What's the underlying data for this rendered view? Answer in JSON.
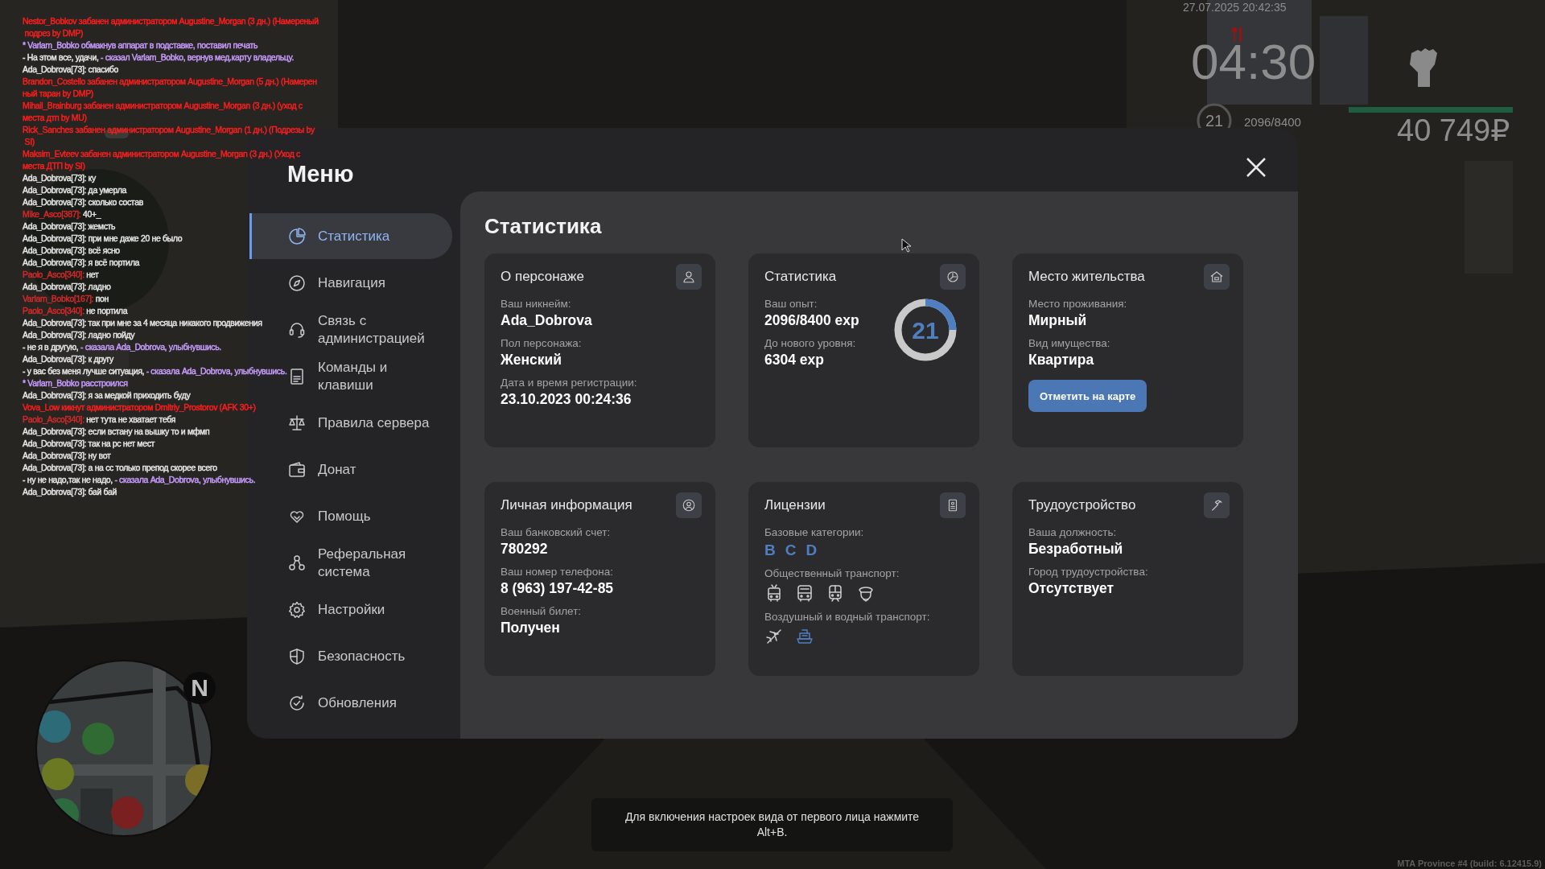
{
  "chat": [
    {
      "segments": [
        {
          "text": "Nestor_Bobkov забанен администратором Augustine_Morgan (3 дн.) (Намереный",
          "color": "#ff1e1e"
        }
      ]
    },
    {
      "segments": [
        {
          "text": " подрез by DMP)",
          "color": "#ff1e1e"
        }
      ]
    },
    {
      "segments": [
        {
          "text": "* Varlam_Bobko обмакнув аппарат в подставке, поставил печать",
          "color": "#c99cff"
        }
      ]
    },
    {
      "segments": [
        {
          "text": "- На этом все, удачи, ",
          "color": "#e6e6e6"
        },
        {
          "text": "- сказал Varlam_Bobko, вернув мед.карту владельцу.",
          "color": "#c99cff"
        }
      ]
    },
    {
      "segments": [
        {
          "text": "Ada_Dobrova[73]: спасибо",
          "color": "#e6e6e6"
        }
      ]
    },
    {
      "segments": [
        {
          "text": "Brandon_Costello забанен администратором Augustine_Morgan (5 дн.) (Намерен",
          "color": "#ff1e1e"
        }
      ]
    },
    {
      "segments": [
        {
          "text": "ный таран by DMP)",
          "color": "#ff1e1e"
        }
      ]
    },
    {
      "segments": [
        {
          "text": "Mihail_Brainburg забанен администратором Augustine_Morgan (3 дн.) (уход с",
          "color": "#ff1e1e"
        }
      ]
    },
    {
      "segments": [
        {
          "text": "места дтп by MU)",
          "color": "#ff1e1e"
        }
      ]
    },
    {
      "segments": [
        {
          "text": "Rick_Sanches забанен администратором Augustine_Morgan (1 дн.) (Подрезы by",
          "color": "#ff1e1e"
        }
      ]
    },
    {
      "segments": [
        {
          "text": " SI)",
          "color": "#ff1e1e"
        }
      ]
    },
    {
      "segments": [
        {
          "text": "Maksim_Evteev забанен администратором Augustine_Morgan (3 дн.) (Уход с",
          "color": "#ff1e1e"
        }
      ]
    },
    {
      "segments": [
        {
          "text": "места ДТП by SI)",
          "color": "#ff1e1e"
        }
      ]
    },
    {
      "segments": [
        {
          "text": "Ada_Dobrova[73]: ку",
          "color": "#e6e6e6"
        }
      ]
    },
    {
      "segments": [
        {
          "text": "Ada_Dobrova[73]: да умерла",
          "color": "#e6e6e6"
        }
      ]
    },
    {
      "segments": [
        {
          "text": "Ada_Dobrova[73]: сколько состав",
          "color": "#e6e6e6"
        }
      ]
    },
    {
      "segments": [
        {
          "text": "Mike_Asco[387]:",
          "color": "#d42a2a"
        },
        {
          "text": " 40+_",
          "color": "#e6e6e6"
        }
      ]
    },
    {
      "segments": [
        {
          "text": "Ada_Dobrova[73]: жемсть",
          "color": "#e6e6e6"
        }
      ]
    },
    {
      "segments": [
        {
          "text": "Ada_Dobrova[73]: при мне даже 20 не было",
          "color": "#e6e6e6"
        }
      ]
    },
    {
      "segments": [
        {
          "text": "Ada_Dobrova[73]: всё ясно",
          "color": "#e6e6e6"
        }
      ]
    },
    {
      "segments": [
        {
          "text": "Ada_Dobrova[73]: я всё портила",
          "color": "#e6e6e6"
        }
      ]
    },
    {
      "segments": [
        {
          "text": "Paolo_Asco[340]:",
          "color": "#d42a2a"
        },
        {
          "text": " нет",
          "color": "#e6e6e6"
        }
      ]
    },
    {
      "segments": [
        {
          "text": "Ada_Dobrova[73]: ладно",
          "color": "#e6e6e6"
        }
      ]
    },
    {
      "segments": [
        {
          "text": "Varlam_Bobko[167]:",
          "color": "#d42a2a"
        },
        {
          "text": " пон",
          "color": "#e6e6e6"
        }
      ]
    },
    {
      "segments": [
        {
          "text": "Paolo_Asco[340]:",
          "color": "#d42a2a"
        },
        {
          "text": " не портила",
          "color": "#e6e6e6"
        }
      ]
    },
    {
      "segments": [
        {
          "text": "Ada_Dobrova[73]: так при мне за 4 месяца никакого продвижения",
          "color": "#e6e6e6"
        }
      ]
    },
    {
      "segments": [
        {
          "text": "Ada_Dobrova[73]: ладно пойду",
          "color": "#e6e6e6"
        }
      ]
    },
    {
      "segments": [
        {
          "text": "- не я в другую, ",
          "color": "#e6e6e6"
        },
        {
          "text": "- сказала Ada_Dobrova, улыбнувшись.",
          "color": "#c99cff"
        }
      ]
    },
    {
      "segments": [
        {
          "text": "Ada_Dobrova[73]: к другу",
          "color": "#e6e6e6"
        }
      ]
    },
    {
      "segments": [
        {
          "text": "- у вас без меня лучше ситуация, ",
          "color": "#e6e6e6"
        },
        {
          "text": "- сказала Ada_Dobrova, улыбнувшись.",
          "color": "#c99cff"
        }
      ]
    },
    {
      "segments": [
        {
          "text": "* Varlam_Bobko расстроился",
          "color": "#c99cff"
        }
      ]
    },
    {
      "segments": [
        {
          "text": "Ada_Dobrova[73]: я за медкой приходить буду",
          "color": "#e6e6e6"
        }
      ]
    },
    {
      "segments": [
        {
          "text": "Vova_Low кикнут администратором Dmitriy_Prostorov (AFK 30+)",
          "color": "#ff1e1e"
        }
      ]
    },
    {
      "segments": [
        {
          "text": "Paolo_Asco[340]:",
          "color": "#d42a2a"
        },
        {
          "text": " нет тута не хватает тебя",
          "color": "#e6e6e6"
        }
      ]
    },
    {
      "segments": [
        {
          "text": "Ada_Dobrova[73]: если встану на вышку то и мфмп",
          "color": "#e6e6e6"
        }
      ]
    },
    {
      "segments": [
        {
          "text": "Ada_Dobrova[73]: так на рс нет мест",
          "color": "#e6e6e6"
        }
      ]
    },
    {
      "segments": [
        {
          "text": "Ada_Dobrova[73]: ну вот",
          "color": "#e6e6e6"
        }
      ]
    },
    {
      "segments": [
        {
          "text": "Ada_Dobrova[73]: а на сс только препод скорее всего",
          "color": "#e6e6e6"
        }
      ]
    },
    {
      "segments": [
        {
          "text": "- ну не надо,так не надо, ",
          "color": "#e6e6e6"
        },
        {
          "text": "- сказала Ada_Dobrova, улыбнувшись.",
          "color": "#c99cff"
        }
      ]
    },
    {
      "segments": [
        {
          "text": "Ada_Dobrova[73]: бай бай",
          "color": "#e6e6e6"
        }
      ]
    }
  ],
  "hud": {
    "datetime": "27.07.2025 20:42:35",
    "time": "04:30",
    "level_badge": "21",
    "experience": "2096/8400",
    "health": {
      "level": 1
    },
    "money": "40 749₽"
  },
  "minimap": {
    "north": "N"
  },
  "menu": {
    "title": "Меню",
    "sidebar": {
      "items": [
        {
          "label": "Статистика",
          "selected": true
        },
        {
          "label": "Навигация",
          "selected": false
        },
        {
          "label": "Связь с администрацией",
          "selected": false
        },
        {
          "label": "Команды и клавиши",
          "selected": false
        },
        {
          "label": "Правила сервера",
          "selected": false
        },
        {
          "label": "Донат",
          "selected": false
        },
        {
          "label": "Помощь",
          "selected": false
        },
        {
          "label": "Реферальная система",
          "selected": false
        },
        {
          "label": "Настройки",
          "selected": false
        },
        {
          "label": "Безопасность",
          "selected": false
        },
        {
          "label": "Обновления",
          "selected": false
        }
      ]
    },
    "page_title": "Статистика",
    "cards": [
      {
        "title": "О персонаже",
        "fields": [
          {
            "label": "Ваш никнейм:",
            "value": "Ada_Dobrova"
          },
          {
            "label": "Пол персонажа:",
            "value": "Женский"
          },
          {
            "label": "Дата и время регистрации:",
            "value": "23.10.2023 00:24:36"
          }
        ]
      },
      {
        "title": "Статистика",
        "fields": [
          {
            "label": "Ваш опыт:",
            "value": "2096/8400 exp"
          },
          {
            "label": "До нового уровня:",
            "value": "6304 exp"
          }
        ],
        "level_ring": {
          "value": "21",
          "level": 0.25
        }
      },
      {
        "title": "Место жительства",
        "fields": [
          {
            "label": "Место проживания:",
            "value": "Мирный"
          },
          {
            "label": "Вид имущества:",
            "value": "Квартира"
          }
        ],
        "button": "Отметить на карте"
      },
      {
        "title": "Личная информация",
        "fields": [
          {
            "label": "Ваш банковский счет:",
            "value": "780292"
          },
          {
            "label": "Ваш номер телефона:",
            "value": "8 (963) 197-42-85"
          },
          {
            "label": "Военный билет:",
            "value": "Получен"
          }
        ]
      },
      {
        "title": "Лицензии",
        "sections": [
          {
            "label": "Базовые категории:",
            "kind": "letters",
            "items": [
              {
                "text": "B",
                "held": true
              },
              {
                "text": "C",
                "held": true
              },
              {
                "text": "D",
                "held": true
              }
            ]
          },
          {
            "label": "Общественный транспорт:",
            "kind": "icons",
            "items": [
              {
                "kind": "trolleybus",
                "held": false
              },
              {
                "kind": "bus",
                "held": false
              },
              {
                "kind": "tram",
                "held": false
              },
              {
                "kind": "cap",
                "held": false
              }
            ]
          },
          {
            "label": "Воздушный и водный транспорт:",
            "kind": "icons",
            "items": [
              {
                "kind": "plane",
                "held": false
              },
              {
                "kind": "boat",
                "held": true
              }
            ]
          }
        ]
      },
      {
        "title": "Трудоустройство",
        "fields": [
          {
            "label": "Ваша должность:",
            "value": "Безработный"
          },
          {
            "label": "Город трудоустройства:",
            "value": "Отсутствует"
          }
        ]
      }
    ]
  },
  "hint": "Для включения настроек вида от первого лица нажмите Alt+B.",
  "version": "MTA Province #4 (build: 6.12415.9)"
}
